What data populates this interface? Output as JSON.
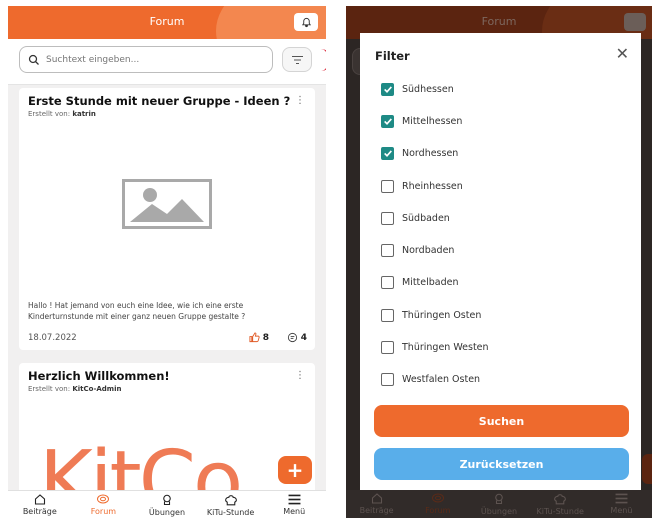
{
  "colors": {
    "accent": "#ee6a2d",
    "checkbox": "#1e8a85",
    "reset": "#59aeea"
  },
  "left": {
    "header": {
      "title": "Forum",
      "bell_icon": "bell-icon"
    },
    "search": {
      "placeholder": "Suchtext eingeben..."
    },
    "posts": [
      {
        "title": "Erste Stunde mit neuer Gruppe - Ideen ?",
        "author_prefix": "Erstellt von:",
        "author": "katrin",
        "body": "Hallo ! Hat jemand von euch eine Idee, wie ich eine erste Kinderturnstunde mit einer ganz neuen Gruppe gestalte ?",
        "date": "18.07.2022",
        "likes": "8",
        "comments": "4"
      },
      {
        "title": "Herzlich Willkommen!",
        "author_prefix": "Erstellt von:",
        "author": "KitCo-Admin",
        "logo_text": "KitCo"
      }
    ],
    "fab_label": "+",
    "nav": [
      {
        "label": "Beiträge",
        "icon": "home-icon"
      },
      {
        "label": "Forum",
        "icon": "forum-icon",
        "active": true
      },
      {
        "label": "Übungen",
        "icon": "exercise-icon"
      },
      {
        "label": "KiTu-Stunde",
        "icon": "session-icon"
      },
      {
        "label": "Menü",
        "icon": "menu-icon"
      }
    ]
  },
  "right": {
    "header": {
      "title": "Forum"
    },
    "filter": {
      "title": "Filter",
      "options": [
        {
          "label": "Südhessen",
          "checked": true
        },
        {
          "label": "Mittelhessen",
          "checked": true
        },
        {
          "label": "Nordhessen",
          "checked": true
        },
        {
          "label": "Rheinhessen",
          "checked": false
        },
        {
          "label": "Südbaden",
          "checked": false
        },
        {
          "label": "Nordbaden",
          "checked": false
        },
        {
          "label": "Mittelbaden",
          "checked": false
        },
        {
          "label": "Thüringen Osten",
          "checked": false
        },
        {
          "label": "Thüringen Westen",
          "checked": false
        },
        {
          "label": "Westfalen Osten",
          "checked": false
        }
      ],
      "search_button": "Suchen",
      "reset_button": "Zurücksetzen"
    },
    "nav": [
      {
        "label": "Beiträge"
      },
      {
        "label": "Forum",
        "active": true
      },
      {
        "label": "Übungen"
      },
      {
        "label": "KiTu-Stunde"
      },
      {
        "label": "Menü"
      }
    ]
  }
}
